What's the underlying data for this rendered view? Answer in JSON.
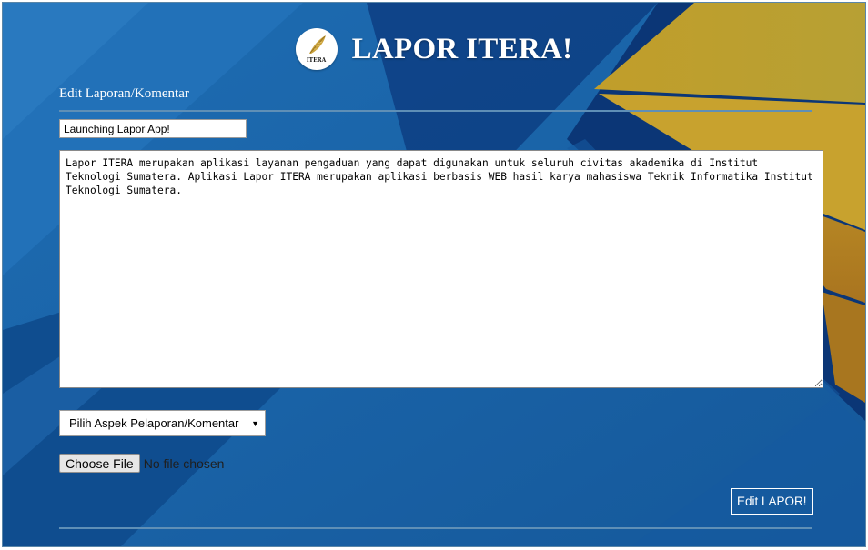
{
  "header": {
    "logo_text": "ITERA",
    "title": "LAPOR ITERA!"
  },
  "form": {
    "section_title": "Edit Laporan/Komentar",
    "title_value": "Launching Lapor App!",
    "body_value": "Lapor ITERA merupakan aplikasi layanan pengaduan yang dapat digunakan untuk seluruh civitas akademika di Institut Teknologi Sumatera. Aplikasi Lapor ITERA merupakan aplikasi berbasis WEB hasil karya mahasiswa Teknik Informatika Institut Teknologi Sumatera.",
    "aspect_select": "Pilih Aspek Pelaporan/Komentar",
    "choose_file_label": "Choose File",
    "file_status": "No file chosen",
    "submit_label": "Edit LAPOR!"
  },
  "colors": {
    "background_blue": "#1660a4",
    "dark_blue": "#0b3676",
    "gold": "#c9a62c",
    "rule": "#5f8fb6"
  },
  "icons": {
    "logo": "itera-leaf-logo-icon",
    "select_arrow": "dropdown-arrow-icon"
  }
}
